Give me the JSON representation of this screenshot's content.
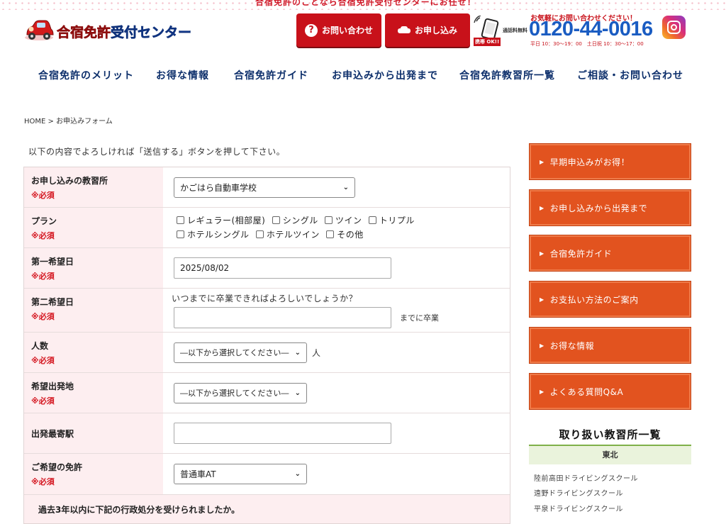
{
  "top_banner": "合宿免許のことなら合宿免許受付センターにお任せ！",
  "logo": {
    "text_red": "合宿免許",
    "text_blue": "受付センター"
  },
  "header": {
    "contact_label": "お問い合わせ",
    "apply_label": "お申し込み",
    "phone_ok": "携帯 OK!!",
    "free_label": "通話料無料",
    "phone_top": "お気軽にお問い合わせください！",
    "phone_number": "0120-44-0016",
    "phone_hours": "平日 10：30〜19：00　土日祝 10：30〜17：00",
    "icons": {
      "contact": "question-icon",
      "apply": "car-icon",
      "phone": "mobile-phone-icon",
      "social": "instagram-icon"
    }
  },
  "nav": [
    "合宿免許のメリット",
    "お得な情報",
    "合宿免許ガイド",
    "お申込みから出発まで",
    "合宿免許教習所一覧",
    "ご相談・お問い合わせ"
  ],
  "breadcrumb": "HOME > お申込みフォーム",
  "intro": "以下の内容でよろしければ「送信する」ボタンを押して下さい。",
  "required_label": "※必須",
  "form": {
    "school": {
      "label": "お申し込みの教習所",
      "value": "かごはら自動車学校"
    },
    "plan": {
      "label": "プラン",
      "options": [
        "レギュラー(相部屋)",
        "シングル",
        "ツイン",
        "トリプル",
        "ホテルシングル",
        "ホテルツイン",
        "その他"
      ]
    },
    "date1": {
      "label": "第一希望日",
      "value": "2025/08/02"
    },
    "date2": {
      "label": "第二希望日",
      "question": "いつまでに卒業できればよろしいでしょうか？",
      "value": "",
      "suffix": "までに卒業"
    },
    "people": {
      "label": "人数",
      "value": "―以下から選択してください―",
      "suffix": "人"
    },
    "departure": {
      "label": "希望出発地",
      "value": "―以下から選択してください―"
    },
    "station": {
      "label": "出発最寄駅",
      "value": ""
    },
    "license": {
      "label": "ご希望の免許",
      "value": "普通車AT"
    },
    "penalty_question": "過去3年以内に下記の行政処分を受けられましたか。"
  },
  "sidebar": {
    "buttons": [
      "早期申込みがお得！",
      "お申し込みから出発まで",
      "合宿免許ガイド",
      "お支払い方法のご案内",
      "お得な情報",
      "よくある質問Q&A"
    ],
    "list_title": "取り扱い教習所一覧",
    "region": "東北",
    "schools": [
      "陸前高田ドライビングスクール",
      "遠野ドライビングスクール",
      "平泉ドライビングスクール"
    ]
  },
  "colors": {
    "accent_red": "#c8111a",
    "nav_blue": "#0d2f6b",
    "phone_blue": "#1a5cc2",
    "side_orange": "#e2531f",
    "label_pink": "#fdeef0"
  }
}
